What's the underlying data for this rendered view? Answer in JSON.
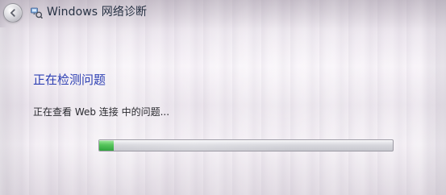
{
  "window": {
    "title": "Windows 网络诊断"
  },
  "content": {
    "section_title": "正在检测问题",
    "status_text": "正在查看 Web 连接 中的问题..."
  },
  "progress": {
    "value_fraction": 0.05
  },
  "icons": {
    "back": "back-arrow-icon",
    "app": "network-diagnostics-icon"
  },
  "colors": {
    "title_blue": "#2d3fb3",
    "progress_green": "#53c458"
  }
}
